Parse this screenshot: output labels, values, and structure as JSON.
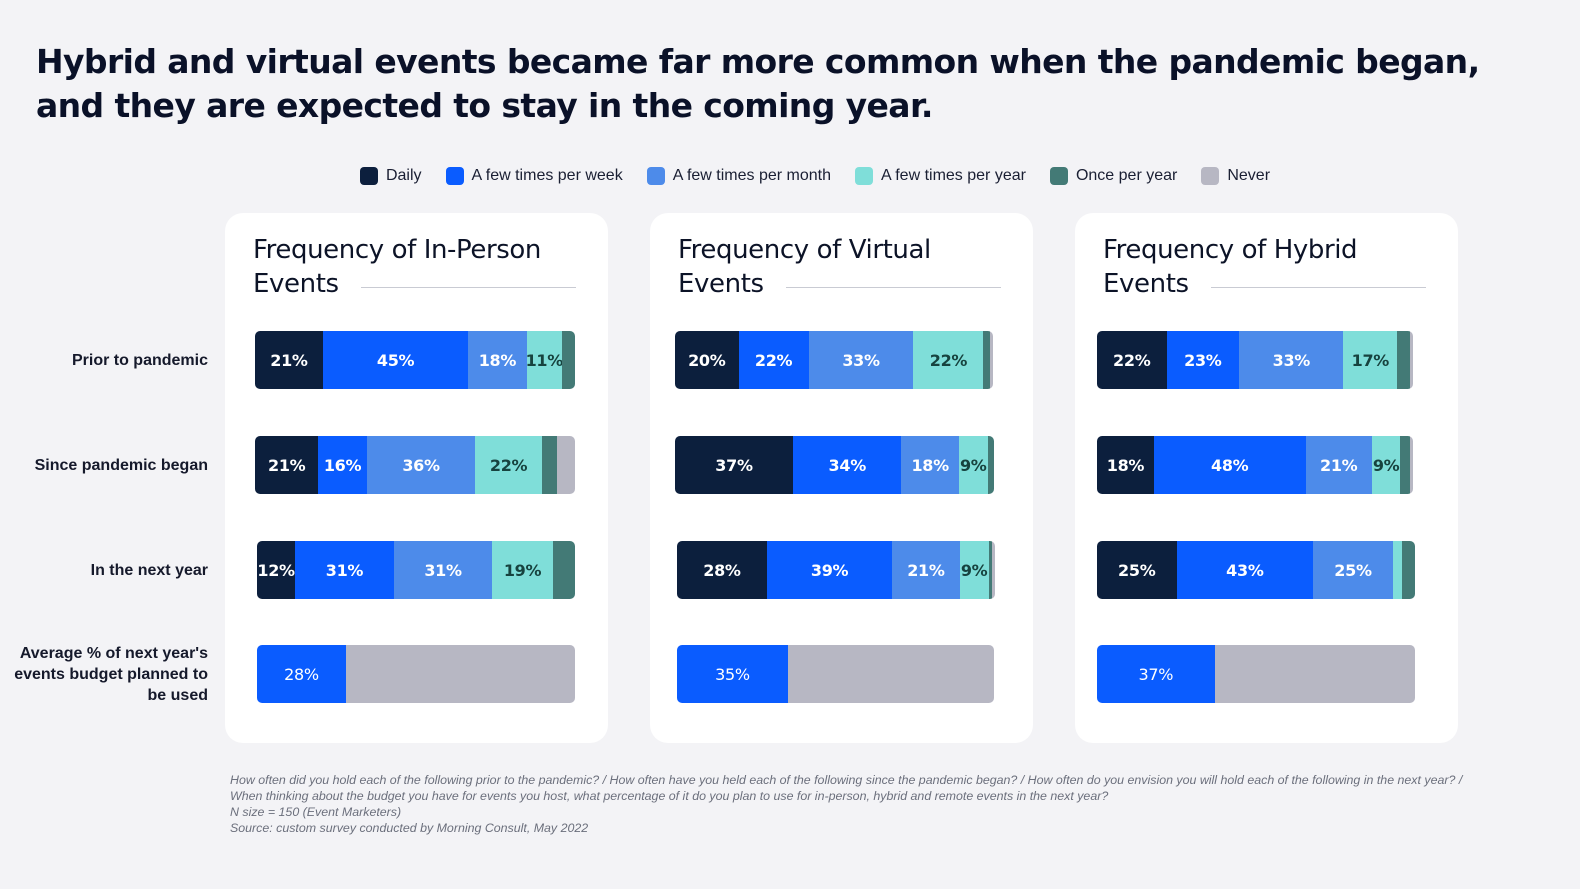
{
  "title": "Hybrid and virtual events became far more common when the pandemic began, and they are expected to stay in the coming year.",
  "legend": [
    {
      "label": "Daily",
      "color": "#0c1f3d"
    },
    {
      "label": "A few times per week",
      "color": "#0a5cff"
    },
    {
      "label": "A few times per month",
      "color": "#4d8bea"
    },
    {
      "label": "A few times per year",
      "color": "#7fded9"
    },
    {
      "label": "Once per year",
      "color": "#437a76"
    },
    {
      "label": "Never",
      "color": "#b7b7c3"
    }
  ],
  "row_labels": [
    "Prior to pandemic",
    "Since pandemic began",
    "In the next year",
    "Average % of next year's events budget planned to be used"
  ],
  "budget_colors": {
    "used": "#0a5cff",
    "rest": "#b7b7c3"
  },
  "chart_data": [
    {
      "type": "bar",
      "orientation": "horizontal-stacked",
      "title": "Frequency of In-Person Events",
      "categories": [
        "Prior to pandemic",
        "Since pandemic began",
        "In the next year"
      ],
      "series_names": [
        "Daily",
        "A few times per week",
        "A few times per month",
        "A few times per year",
        "Once per year",
        "Never"
      ],
      "rows": [
        {
          "values": [
            21,
            45,
            18,
            11,
            4,
            0
          ],
          "labels": [
            "21%",
            "45%",
            "18%",
            "11%",
            "",
            ""
          ]
        },
        {
          "values": [
            21,
            16,
            36,
            22,
            5,
            6
          ],
          "labels": [
            "21%",
            "16%",
            "36%",
            "22%",
            "",
            ""
          ]
        },
        {
          "values": [
            12,
            31,
            31,
            19,
            7,
            0
          ],
          "labels": [
            "12%",
            "31%",
            "31%",
            "19%",
            "",
            ""
          ]
        }
      ],
      "budget": {
        "value": 28,
        "label": "28%"
      },
      "xlim": [
        0,
        100
      ]
    },
    {
      "type": "bar",
      "orientation": "horizontal-stacked",
      "title": "Frequency of Virtual Events",
      "categories": [
        "Prior to pandemic",
        "Since pandemic began",
        "In the next year"
      ],
      "series_names": [
        "Daily",
        "A few times per week",
        "A few times per month",
        "A few times per year",
        "Once per year",
        "Never"
      ],
      "rows": [
        {
          "values": [
            20,
            22,
            33,
            22,
            2,
            1
          ],
          "labels": [
            "20%",
            "22%",
            "33%",
            "22%",
            "",
            ""
          ]
        },
        {
          "values": [
            37,
            34,
            18,
            9,
            2,
            0
          ],
          "labels": [
            "37%",
            "34%",
            "18%",
            "9%",
            "",
            ""
          ]
        },
        {
          "values": [
            28,
            39,
            21,
            9,
            1,
            1
          ],
          "labels": [
            "28%",
            "39%",
            "21%",
            "9%",
            "",
            ""
          ]
        }
      ],
      "budget": {
        "value": 35,
        "label": "35%"
      },
      "xlim": [
        0,
        100
      ]
    },
    {
      "type": "bar",
      "orientation": "horizontal-stacked",
      "title": "Frequency of Hybrid Events",
      "categories": [
        "Prior to pandemic",
        "Since pandemic began",
        "In the next year"
      ],
      "series_names": [
        "Daily",
        "A few times per week",
        "A few times per month",
        "A few times per year",
        "Once per year",
        "Never"
      ],
      "rows": [
        {
          "values": [
            22,
            23,
            33,
            17,
            4,
            1
          ],
          "labels": [
            "22%",
            "23%",
            "33%",
            "17%",
            "",
            ""
          ]
        },
        {
          "values": [
            18,
            48,
            21,
            9,
            3,
            1
          ],
          "labels": [
            "18%",
            "48%",
            "21%",
            "9%",
            "",
            ""
          ]
        },
        {
          "values": [
            25,
            43,
            25,
            3,
            4,
            0
          ],
          "labels": [
            "25%",
            "43%",
            "25%",
            "",
            "",
            ""
          ]
        }
      ],
      "budget": {
        "value": 37,
        "label": "37%"
      },
      "xlim": [
        0,
        100
      ]
    }
  ],
  "footnote": {
    "question": "How often did you hold each of the following prior to the pandemic? / How often have you held each of the following since the pandemic began? / How often do you envision you will hold each of the following in the next year? / When thinking about the budget you have for events you host, what percentage of it do you plan to use for in-person, hybrid and remote events in the next year?",
    "n_size": "N size = 150 (Event Marketers)",
    "source": "Source: custom survey conducted by Morning Consult, May 2022"
  }
}
